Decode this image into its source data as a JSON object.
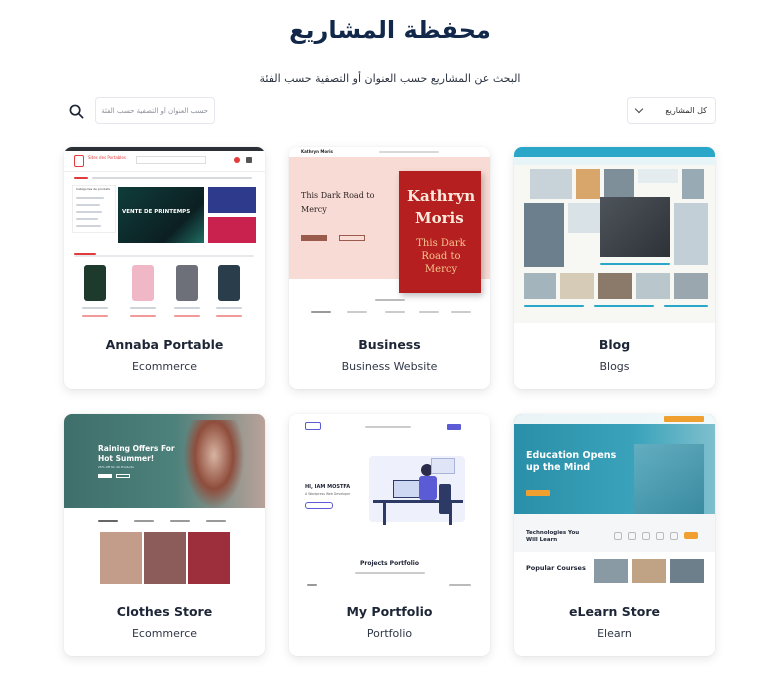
{
  "header": {
    "title": "محفظة المشاريع",
    "subtitle": "البحث عن المشاريع حسب العنوان أو التصفية حسب الفئة"
  },
  "filters": {
    "category_value": "كل المشاريع",
    "search_placeholder": "حسب العنوان أو التصفية حسب الفئة"
  },
  "colors": {
    "title": "#12284a",
    "card_bg": "#ffffff",
    "blog_accent": "#2aa6c9",
    "elearn_accent": "#2a8fa8",
    "portfolio_accent": "#5b5bd6"
  },
  "projects": [
    {
      "title": "Annaba Portable",
      "category": "Ecommerce",
      "preview": {
        "store_name": "Sites des Portables",
        "banner": "VENTE DE PRINTEMPS",
        "sidebar_heading": "Catégories de produits"
      }
    },
    {
      "title": "Business",
      "category": "Business Website",
      "preview": {
        "brand": "Kathryn Moris",
        "headline": "This Dark Road to Mercy",
        "book_author_line1": "Kathryn",
        "book_author_line2": "Moris",
        "book_title": "This Dark Road to Mercy"
      }
    },
    {
      "title": "Blog",
      "category": "Blogs",
      "preview": {}
    },
    {
      "title": "Clothes Store",
      "category": "Ecommerce",
      "preview": {
        "hero_line1": "Raining Offers For",
        "hero_line2": "Hot Summer!",
        "hero_sub": "25% Off On All Products"
      }
    },
    {
      "title": "My Portfolio",
      "category": "Portfolio",
      "preview": {
        "intro_line1": "HI, IAM MOSTFA",
        "intro_line2": "A Wordpress Web Developer",
        "section_title": "Projects Portfolio"
      }
    },
    {
      "title": "eLearn Store",
      "category": "Elearn",
      "preview": {
        "hero_line1": "Education Opens",
        "hero_line2": "up the Mind",
        "tech_line1": "Technologies You",
        "tech_line2": "Will Learn",
        "courses_label": "Popular Courses"
      }
    }
  ]
}
